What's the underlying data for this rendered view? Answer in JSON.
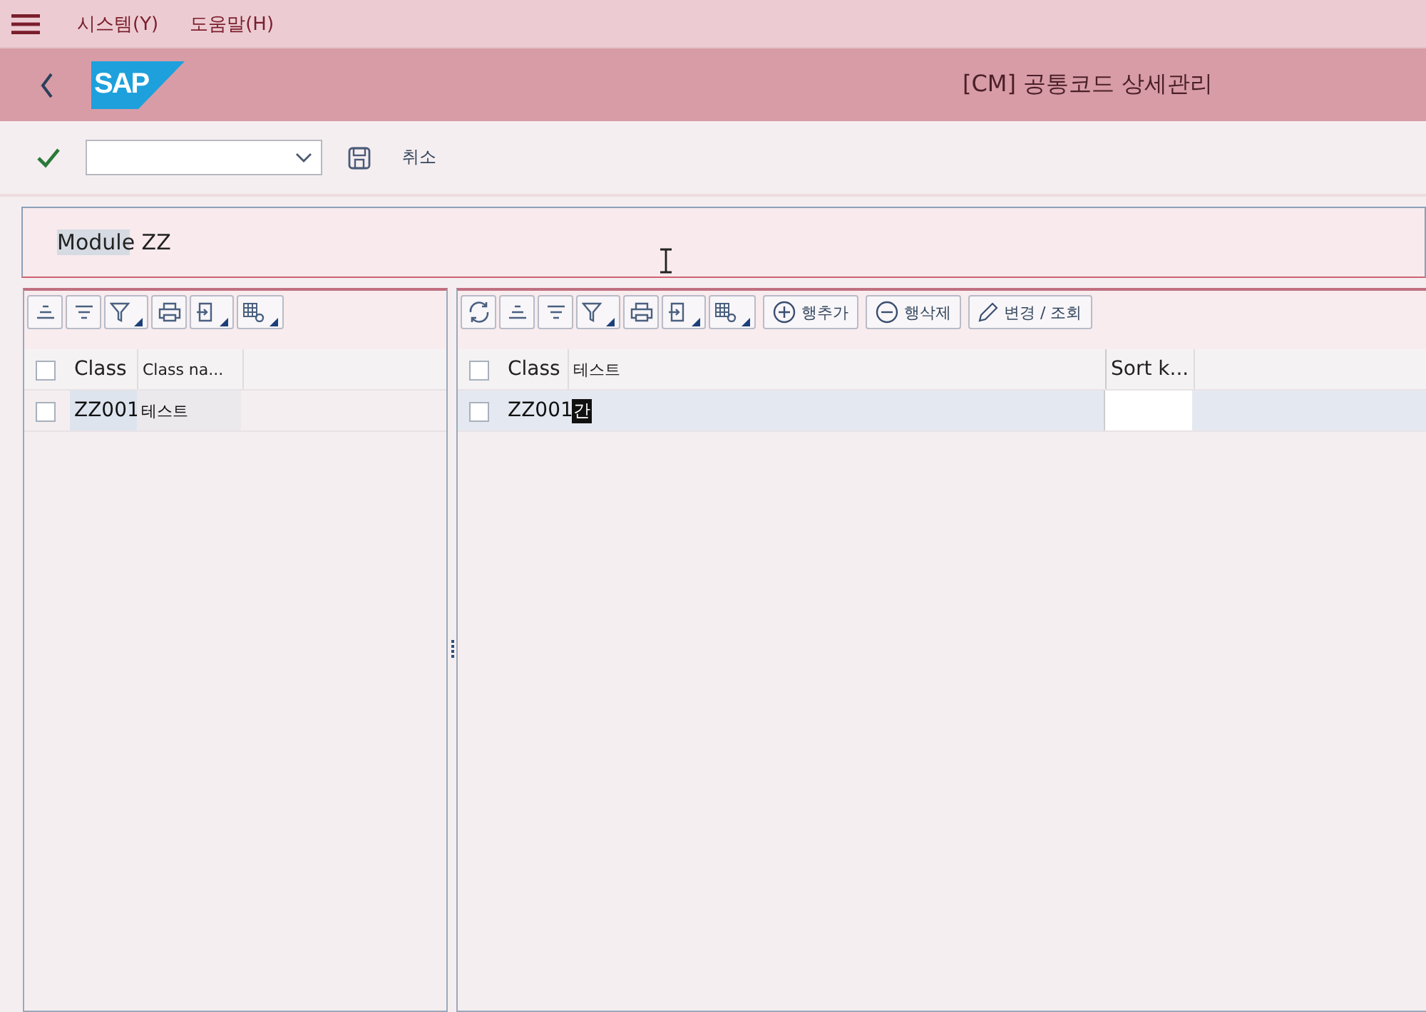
{
  "menu": {
    "items": [
      "시스템(Y)",
      "도움말(H)"
    ]
  },
  "title_bar": {
    "logo": "SAP",
    "title": "[CM] 공통코드 상세관리"
  },
  "toolbar": {
    "cancel_label": "취소"
  },
  "header": {
    "text": "Module ZZ"
  },
  "left_grid": {
    "all_checked": false,
    "columns": [
      "Class",
      "Class na..."
    ],
    "rows": [
      {
        "checked": false,
        "cells": [
          "ZZ001",
          "테스트"
        ]
      }
    ]
  },
  "right_grid": {
    "buttons": [
      {
        "kind": "add",
        "label": "행추가"
      },
      {
        "kind": "delete",
        "label": "행삭제"
      },
      {
        "kind": "edit",
        "label": "변경 / 조회"
      }
    ],
    "all_checked": false,
    "columns": [
      "Class",
      "테스트",
      "Sort k..."
    ],
    "rows": [
      {
        "checked": false,
        "selected": true,
        "cells": [
          "ZZ001",
          "간"
        ]
      }
    ]
  }
}
